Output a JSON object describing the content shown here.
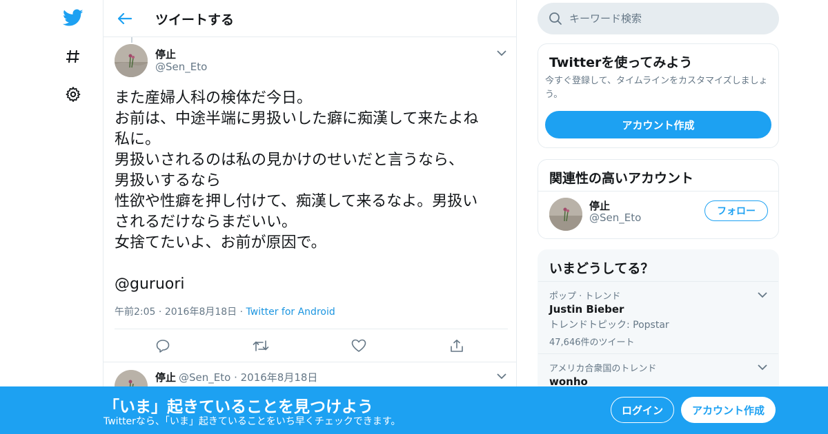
{
  "colors": {
    "accent": "#1da1f2",
    "text": "#14171a",
    "muted": "#657786",
    "border": "#e6ecf0"
  },
  "nav": {
    "icons": [
      "twitter-bird-icon",
      "hashtag-icon",
      "gear-icon"
    ]
  },
  "header": {
    "title": "ツイートする"
  },
  "tweet": {
    "author_name": "停止",
    "author_handle": "@Sen_Eto",
    "text": "また産婦人科の検体だ今日。\nお前は、中途半端に男扱いした癖に痴漢して来たよね\n私に。\n男扱いされるのは私の見かけのせいだと言うなら、\n男扱いするなら\n性欲や性癖を押し付けて、痴漢して来るなよ。男扱い\nされるだけならまだいい。\n女捨てたいよ、お前が原因で。\n\n@guruori",
    "time": "午前2:05",
    "date": "2016年8月18日",
    "source": "Twitter for Android"
  },
  "reply": {
    "author_name": "停止",
    "author_handle": "@Sen_Eto",
    "date": "2016年8月18日"
  },
  "search": {
    "placeholder": "キーワード検索"
  },
  "signup_card": {
    "title": "Twitterを使ってみよう",
    "subtitle": "今すぐ登録して、タイムラインをカスタマイズしましょう。",
    "button": "アカウント作成"
  },
  "related_card": {
    "title": "関連性の高いアカウント",
    "name": "停止",
    "handle": "@Sen_Eto",
    "follow": "フォロー"
  },
  "trends": {
    "title": "いまどうしてる？",
    "items": [
      {
        "context": "ポップ · トレンド",
        "name": "Justin Bieber",
        "desc": "トレンドトピック: Popstar",
        "count": "47,646件のツイート"
      },
      {
        "context": "アメリカ合衆国のトレンド",
        "name": "wonho"
      }
    ]
  },
  "banner": {
    "title": "「いま」起きていることを見つけよう",
    "subtitle": "Twitterなら、「いま」起きていることをいち早くチェックできます。",
    "login": "ログイン",
    "signup": "アカウント作成"
  }
}
